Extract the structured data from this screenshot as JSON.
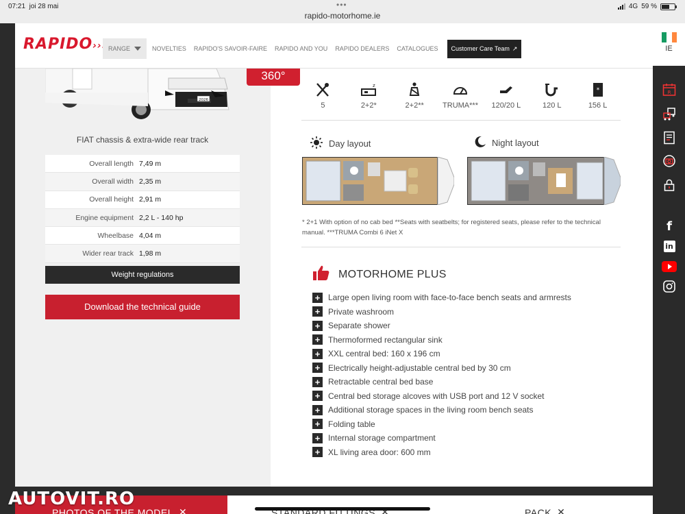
{
  "status_bar": {
    "time": "07:21",
    "date": "joi 28 mai",
    "url": "rapido-motorhome.ie",
    "network": "4G",
    "battery": "59 %",
    "battery_level": 0.59
  },
  "header": {
    "logo": "RAPIDO",
    "nav": {
      "range": "RANGE",
      "items": [
        "NOVELTIES",
        "RAPIDO'S SAVOIR-FAIRE",
        "RAPIDO AND YOU",
        "RAPIDO DEALERS",
        "CATALOGUES"
      ],
      "care_button": "Customer Care Team"
    }
  },
  "side_rail": {
    "language": "IE",
    "flag_colors": [
      "#169b62",
      "#ffffff",
      "#ff883e"
    ]
  },
  "vehicle": {
    "plate": "2026",
    "badge_360": "360°",
    "caption": "FIAT chassis & extra-wide rear track",
    "specs": [
      {
        "label": "Overall length",
        "value": "7,49 m"
      },
      {
        "label": "Overall width",
        "value": "2,35 m"
      },
      {
        "label": "Overall height",
        "value": "2,91 m"
      },
      {
        "label": "Engine equipment",
        "value": "2,2 L - 140 hp"
      },
      {
        "label": "Wheelbase",
        "value": "4,04 m"
      },
      {
        "label": "Wider rear track",
        "value": "1,98 m"
      }
    ],
    "weight_button": "Weight regulations",
    "download_button": "Download the technical guide"
  },
  "capacity": [
    {
      "icon": "cutlery-icon",
      "value": "5"
    },
    {
      "icon": "bed-icon",
      "value": "2+2*"
    },
    {
      "icon": "seat-icon",
      "value": "2+2**"
    },
    {
      "icon": "heater-icon",
      "value": "TRUMA***"
    },
    {
      "icon": "tap-icon",
      "value": "120/20 L"
    },
    {
      "icon": "drain-icon",
      "value": "120 L"
    },
    {
      "icon": "fridge-icon",
      "value": "156 L"
    }
  ],
  "layouts": {
    "day": "Day layout",
    "night": "Night layout"
  },
  "note": "* 2+1 With option of no cab bed **Seats with seatbelts; for registered seats, please refer to the technical manual. ***TRUMA Combi 6 iNet X",
  "plus": {
    "title": "MOTORHOME PLUS",
    "items": [
      "Large open living room with face-to-face bench seats and armrests",
      "Private washroom",
      "Separate shower",
      "Thermoformed rectangular sink",
      "XXL central bed: 160 x 196 cm",
      "Electrically height-adjustable central bed by 30 cm",
      "Retractable central bed base",
      "Central bed storage alcoves with USB port and 12 V socket",
      "Additional storage spaces in the living room bench seats",
      "Folding table",
      "Internal storage compartment",
      "XL living area door: 600 mm"
    ]
  },
  "bottom_tabs": [
    "PHOTOS OF THE MODEL",
    "STANDARD FITTINGS",
    "PACK"
  ],
  "watermark": "AUTOVIT.RO",
  "colors": {
    "brand_red": "#c8202f",
    "dark": "#2a2a2a"
  }
}
